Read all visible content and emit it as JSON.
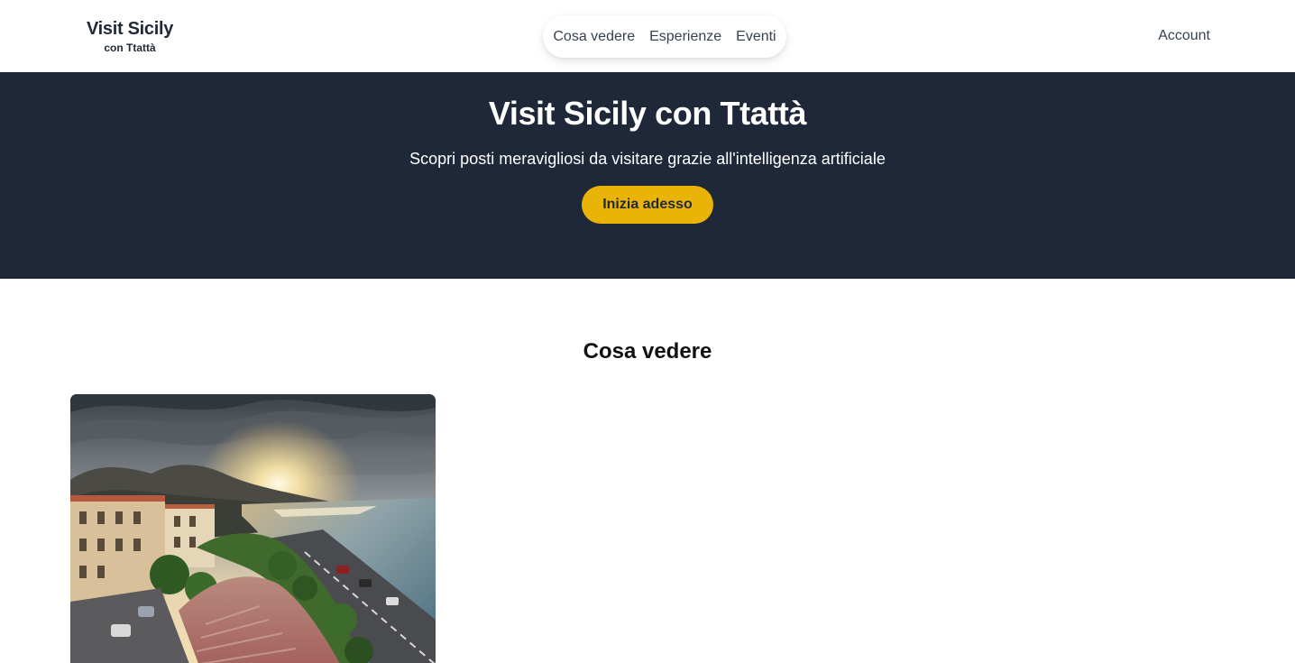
{
  "header": {
    "logo_title": "Visit Sicily",
    "logo_subtitle": "con Ttattà",
    "nav": [
      {
        "label": "Cosa vedere"
      },
      {
        "label": "Esperienze"
      },
      {
        "label": "Eventi"
      }
    ],
    "account_label": "Account"
  },
  "hero": {
    "title": "Visit Sicily con Ttattà",
    "subtitle": "Scopri posti meravigliosi da visitare grazie all'intelligenza artificiale",
    "cta_label": "Inizia adesso"
  },
  "section": {
    "title": "Cosa vedere",
    "cards": [
      {
        "image": "coastal-town-sunset-photo"
      }
    ]
  },
  "colors": {
    "hero_background": "#1f2839",
    "cta_background": "#eab308",
    "text_dark": "#1f2937"
  }
}
